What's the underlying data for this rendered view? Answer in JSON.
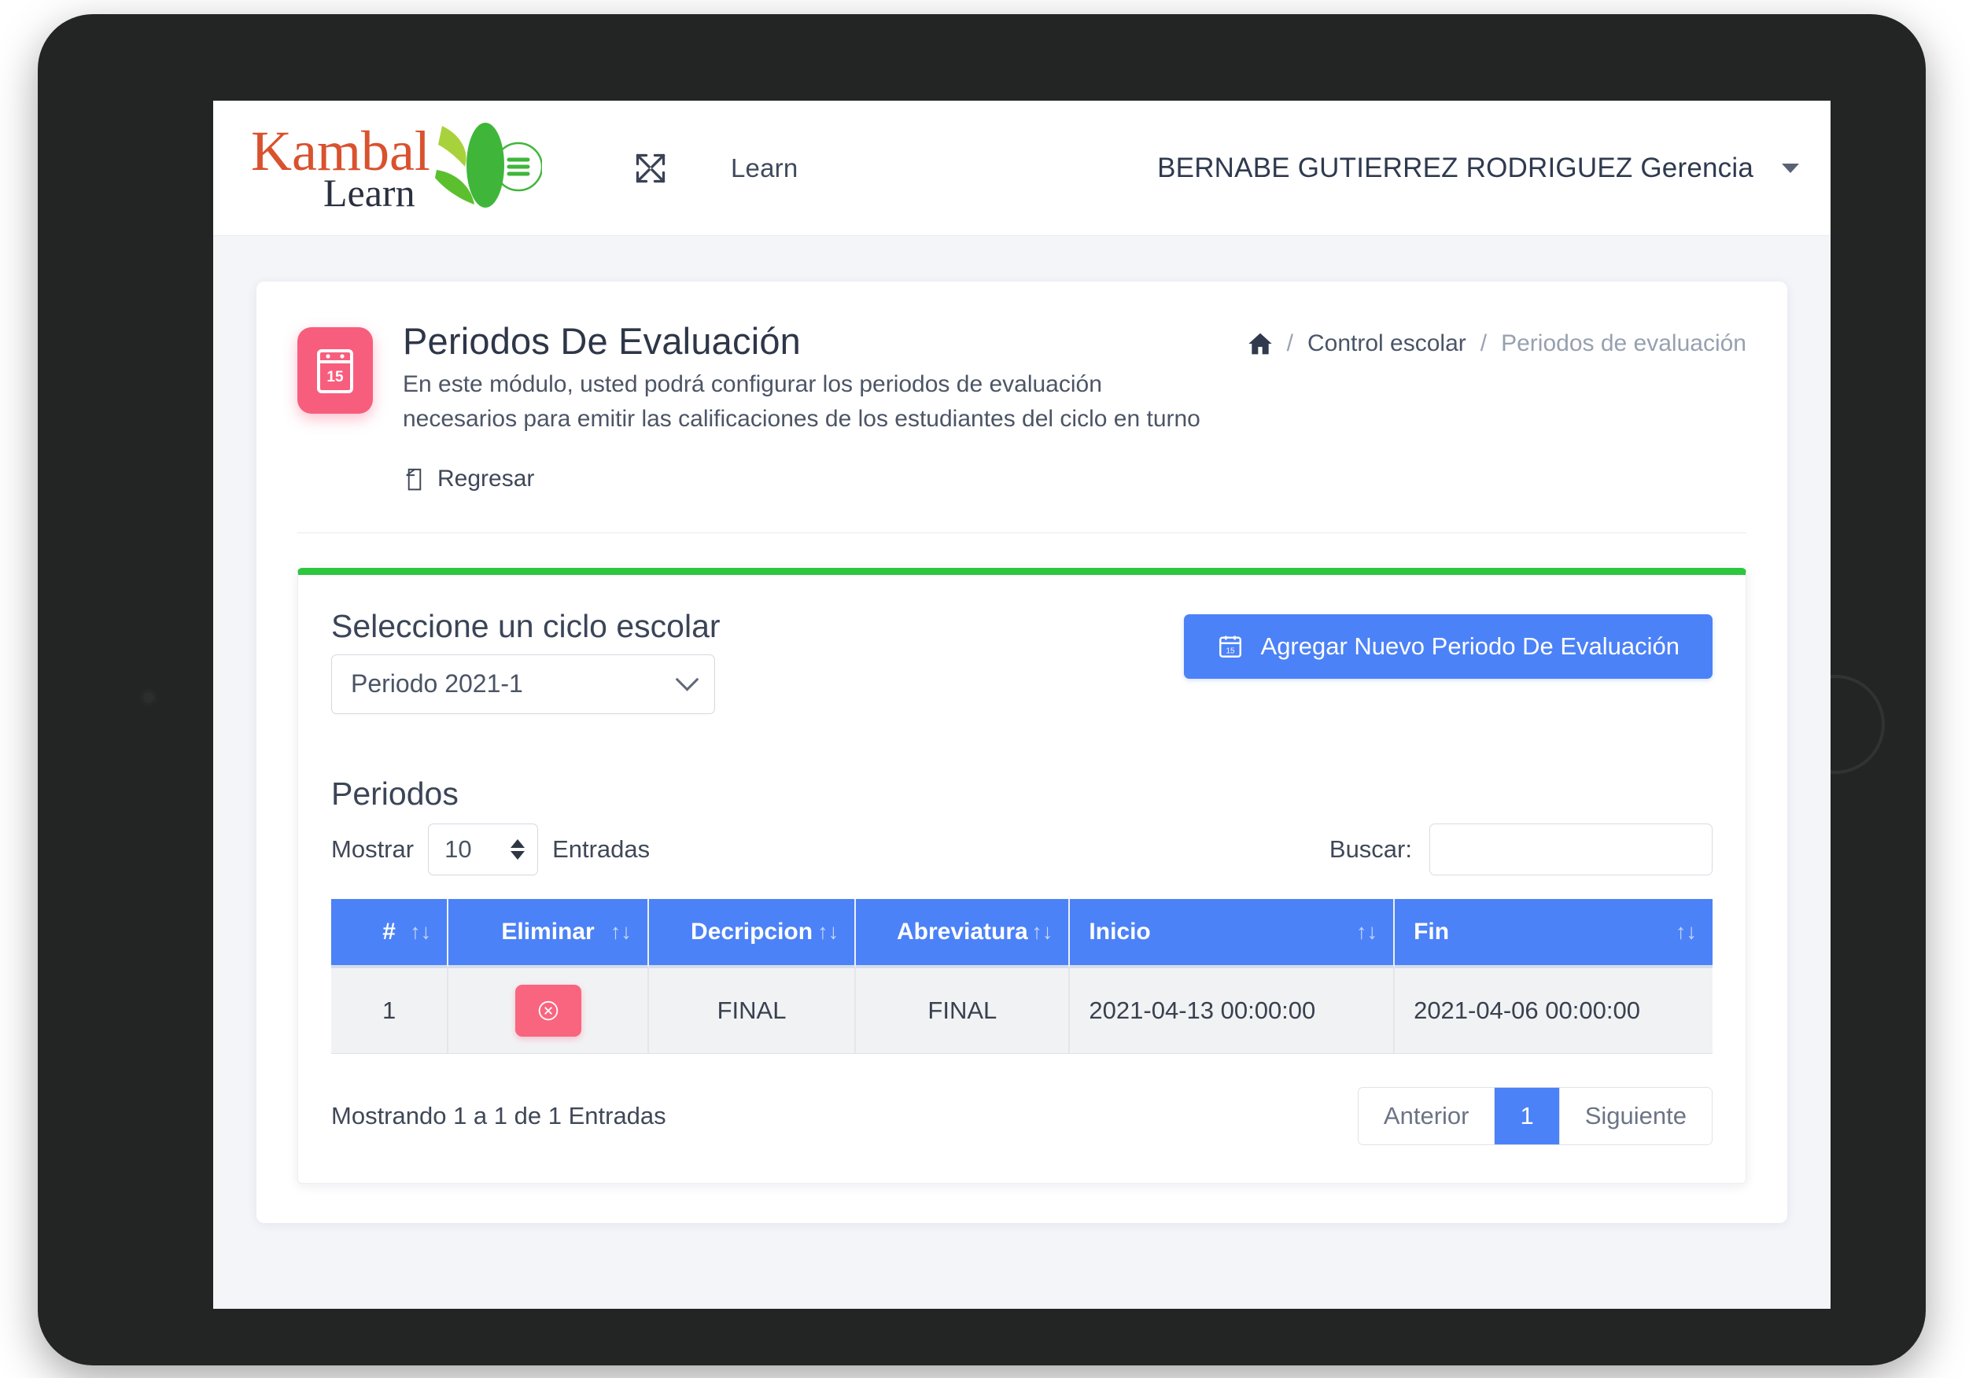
{
  "navbar": {
    "brand_primary": "Kambal",
    "brand_secondary": "Learn",
    "expand_icon": "expand-arrows-icon",
    "menu_icon": "hamburger-menu-icon",
    "nav_link": "Learn",
    "user_name": "BERNABE GUTIERREZ RODRIGUEZ Gerencia",
    "caret_icon": "chevron-down-icon"
  },
  "page": {
    "icon": "calendar-icon",
    "icon_day": "15",
    "title": "Periodos De Evaluación",
    "description_line1": "En este módulo, usted podrá configurar los periodos de evaluación",
    "description_line2": "necesarios para emitir las calificaciones de los estudiantes del ciclo en turno",
    "back_label": "Regresar",
    "back_icon": "reply-arrow-icon"
  },
  "breadcrumb": {
    "home_icon": "home-icon",
    "sep": "/",
    "items": [
      {
        "label": "Control escolar",
        "current": false
      },
      {
        "label": "Periodos de evaluación",
        "current": true
      }
    ]
  },
  "cycle": {
    "label": "Seleccione un ciclo escolar",
    "selected": "Periodo 2021-1",
    "options": [
      "Periodo 2021-1"
    ]
  },
  "add_button": {
    "label": "Agregar Nuevo Periodo De Evaluación",
    "icon": "calendar-add-icon",
    "color": "#4c82f7"
  },
  "table_section": {
    "heading": "Periodos",
    "length_label_before": "Mostrar",
    "length_value": "10",
    "length_label_after": "Entradas",
    "search_label": "Buscar:",
    "search_value": "",
    "search_placeholder": ""
  },
  "table": {
    "columns": [
      {
        "label": "#",
        "align": "center",
        "sortable": true
      },
      {
        "label": "Eliminar",
        "align": "center",
        "sortable": true
      },
      {
        "label": "Decripcion",
        "align": "center",
        "sortable": true
      },
      {
        "label": "Abreviatura",
        "align": "center",
        "sortable": true
      },
      {
        "label": "Inicio",
        "align": "left",
        "sortable": true
      },
      {
        "label": "Fin",
        "align": "left",
        "sortable": true
      }
    ],
    "sort_icon": "↑↓",
    "rows": [
      {
        "num": "1",
        "delete_icon": "circle-x-icon",
        "descripcion": "FINAL",
        "abreviatura": "FINAL",
        "inicio": "2021-04-13 00:00:00",
        "fin": "2021-04-06 00:00:00"
      }
    ]
  },
  "footer": {
    "showing": "Mostrando 1 a 1 de 1 Entradas",
    "prev": "Anterior",
    "page": "1",
    "next": "Siguiente"
  },
  "colors": {
    "accent_blue": "#4c82f7",
    "accent_green": "#2ec63e",
    "accent_pink": "#f75e7d",
    "brand_orange": "#d9522e"
  }
}
